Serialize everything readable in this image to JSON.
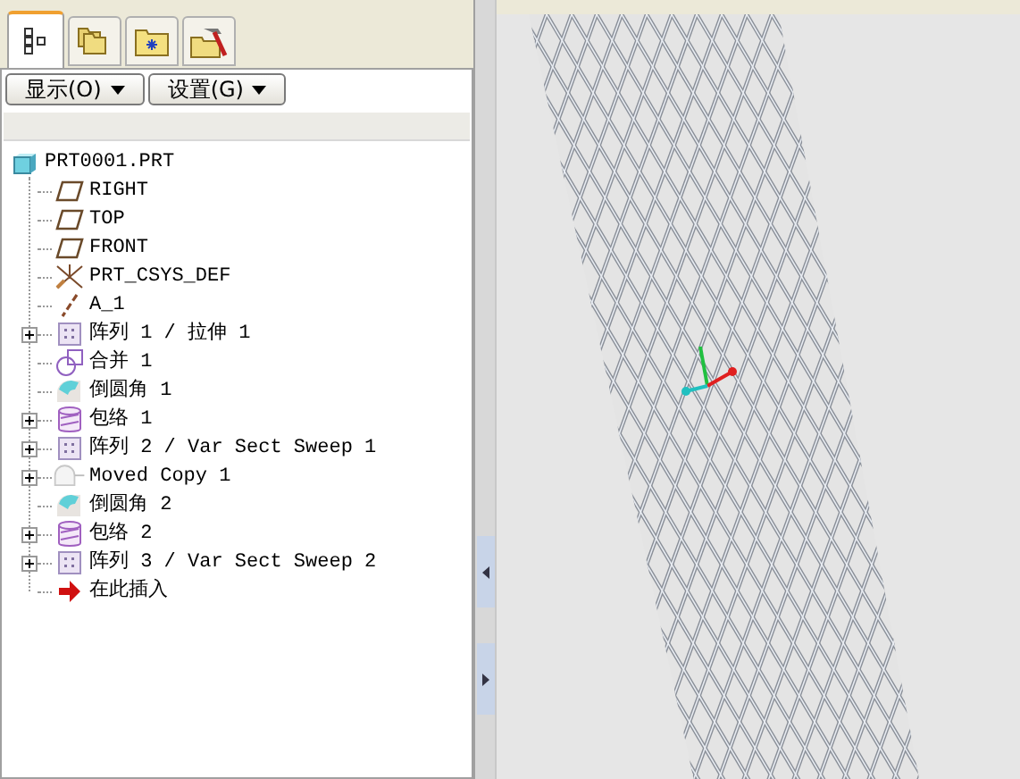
{
  "navigator_tabs": [
    {
      "kind": "model-tree",
      "selected": true
    },
    {
      "kind": "folders",
      "selected": false
    },
    {
      "kind": "favorites",
      "selected": false
    },
    {
      "kind": "tools",
      "selected": false
    }
  ],
  "menu_buttons": [
    {
      "label": "显示(O)"
    },
    {
      "label": "设置(G)"
    }
  ],
  "model_tree": {
    "label": "PRT0001.PRT",
    "kind": "part",
    "children": [
      {
        "label": "RIGHT",
        "kind": "plane"
      },
      {
        "label": "TOP",
        "kind": "plane"
      },
      {
        "label": "FRONT",
        "kind": "plane"
      },
      {
        "label": "PRT_CSYS_DEF",
        "kind": "csys"
      },
      {
        "label": "A_1",
        "kind": "axis"
      },
      {
        "label": "阵列 1 / 拉伸 1",
        "kind": "pattern",
        "expanded": false
      },
      {
        "label": "合并 1",
        "kind": "merge"
      },
      {
        "label": "倒圆角 1",
        "kind": "round"
      },
      {
        "label": "包络 1",
        "kind": "wrap",
        "expanded": false
      },
      {
        "label": "阵列 2 / Var Sect Sweep 1",
        "kind": "pattern",
        "expanded": false
      },
      {
        "label": "Moved Copy 1",
        "kind": "copy",
        "expanded": false
      },
      {
        "label": "倒圆角 2",
        "kind": "round"
      },
      {
        "label": "包络 2",
        "kind": "wrap",
        "expanded": false
      },
      {
        "label": "阵列 3 / Var Sect Sweep 2",
        "kind": "pattern",
        "expanded": false
      },
      {
        "label": "在此插入",
        "kind": "insert"
      }
    ]
  }
}
